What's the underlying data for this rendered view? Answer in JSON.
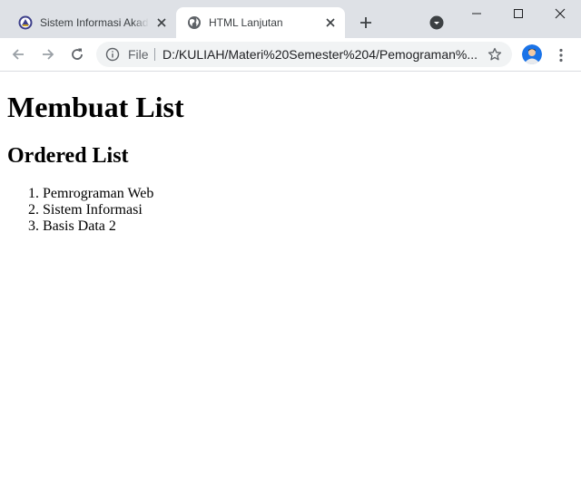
{
  "browser": {
    "tabs": [
      {
        "title": "Sistem Informasi Akademik",
        "active": false,
        "favicon": "university-logo-icon"
      },
      {
        "title": "HTML Lanjutan",
        "active": true,
        "favicon": "globe-icon"
      }
    ],
    "address_bar": {
      "scheme_label": "File",
      "url": "D:/KULIAH/Materi%20Semester%204/Pemograman%..."
    }
  },
  "page": {
    "heading": "Membuat List",
    "subheading": "Ordered List",
    "list_items": [
      "Pemrograman Web",
      "Sistem Informasi",
      "Basis Data 2"
    ]
  },
  "colors": {
    "tabstrip": "#dee1e6",
    "omnibox": "#f1f3f4",
    "avatar": "#1a73e8"
  }
}
